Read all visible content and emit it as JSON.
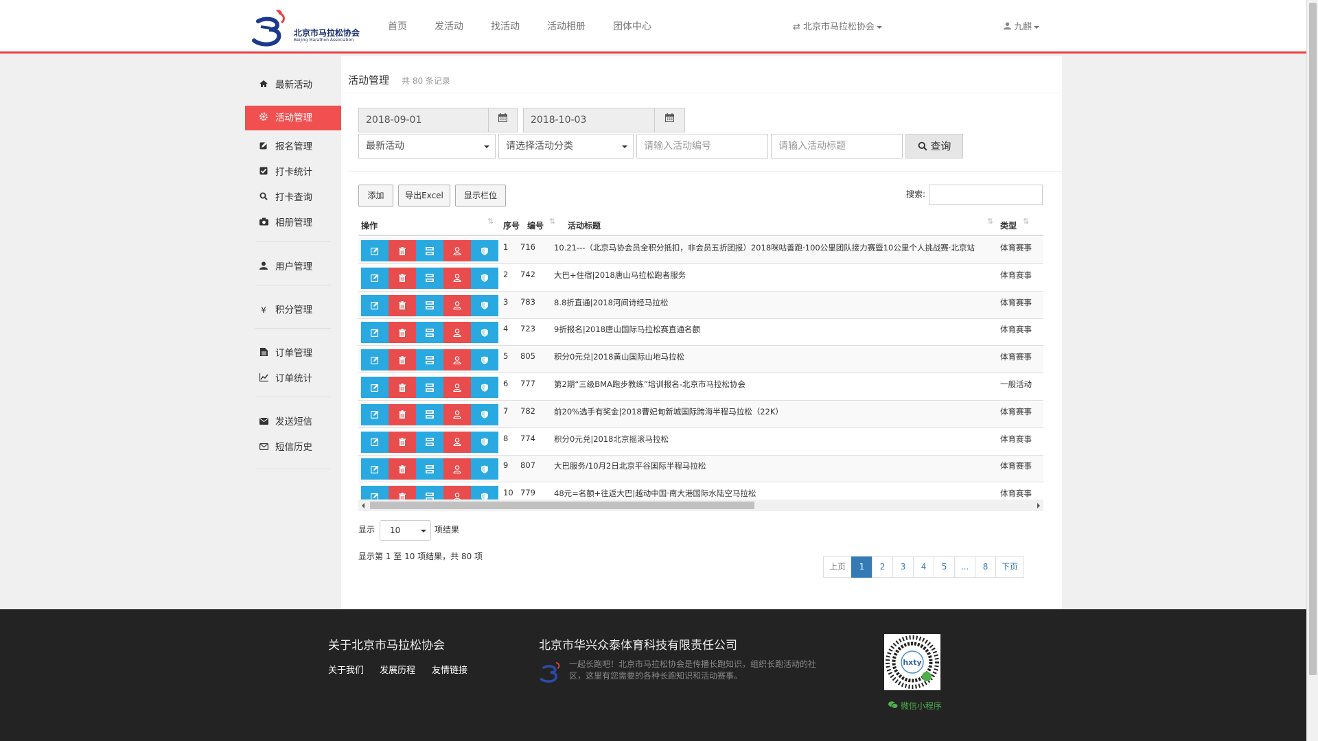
{
  "header": {
    "logo_text": "北京市马拉松协会",
    "logo_subtext": "Beijing Marathon Association",
    "nav": [
      "首页",
      "发活动",
      "找活动",
      "活动相册",
      "团体中心"
    ],
    "org_switch": "北京市马拉松协会",
    "user": "九麒"
  },
  "sidebar": {
    "items": [
      {
        "icon": "home-icon",
        "label": "最新活动"
      },
      {
        "icon": "gear-icon",
        "label": "活动管理"
      },
      {
        "icon": "edit-icon",
        "label": "报名管理"
      },
      {
        "icon": "check-square-icon",
        "label": "打卡统计"
      },
      {
        "icon": "search-icon",
        "label": "打卡查询"
      },
      {
        "icon": "camera-icon",
        "label": "相册管理"
      },
      {
        "icon": "user-icon",
        "label": "用户管理"
      },
      {
        "icon": "yen-icon",
        "label": "积分管理"
      },
      {
        "icon": "file-icon",
        "label": "订单管理"
      },
      {
        "icon": "line-chart-icon",
        "label": "订单统计"
      },
      {
        "icon": "envelope-icon",
        "label": "发送短信"
      },
      {
        "icon": "envelope-outline-icon",
        "label": "短信历史"
      }
    ],
    "active_index": 1
  },
  "main": {
    "title": "活动管理",
    "count": "共 80 条记录"
  },
  "filters": {
    "start_date": "2018-09-01",
    "end_date": "2018-10-03",
    "activity_type": "最新活动",
    "category_placeholder": "请选择活动分类",
    "id_placeholder": "请输入活动编号",
    "title_placeholder": "请输入活动标题",
    "query_label": "查询"
  },
  "toolbar": {
    "add": "添加",
    "export": "导出Excel",
    "columns": "显示栏位",
    "search_label": "搜索:"
  },
  "table": {
    "headers": [
      "操作",
      "序号",
      "编号",
      "活动标题",
      "类型"
    ],
    "rows": [
      {
        "seq": "1",
        "id": "716",
        "title": "10.21---（北京马协会员全积分抵扣，非会员五折团报）2018咪咕善跑·100公里团队接力赛暨10公里个人挑战赛·北京站",
        "type": "体育赛事"
      },
      {
        "seq": "2",
        "id": "742",
        "title": "大巴+住宿|2018唐山马拉松跑者服务",
        "type": "体育赛事"
      },
      {
        "seq": "3",
        "id": "783",
        "title": "8.8折直通|2018河间诗经马拉松",
        "type": "体育赛事"
      },
      {
        "seq": "4",
        "id": "723",
        "title": "9折报名|2018唐山国际马拉松赛直通名额",
        "type": "体育赛事"
      },
      {
        "seq": "5",
        "id": "805",
        "title": "积分0元兑|2018黄山国际山地马拉松",
        "type": "体育赛事"
      },
      {
        "seq": "6",
        "id": "777",
        "title": "第2期“三级BMA跑步教练”培训报名-北京市马拉松协会",
        "type": "一般活动"
      },
      {
        "seq": "7",
        "id": "782",
        "title": "前20%选手有奖金|2018曹妃甸新城国际跨海半程马拉松（22K）",
        "type": "体育赛事"
      },
      {
        "seq": "8",
        "id": "774",
        "title": "积分0元兑|2018北京摇滚马拉松",
        "type": "体育赛事"
      },
      {
        "seq": "9",
        "id": "807",
        "title": "大巴服务/10月2日北京平谷国际半程马拉松",
        "type": "体育赛事"
      },
      {
        "seq": "10",
        "id": "779",
        "title": "48元=名额+往返大巴|越动中国·南大港国际水陆空马拉松",
        "type": "体育赛事"
      }
    ],
    "ops": [
      {
        "name": "edit-icon",
        "color": "#29a9e0"
      },
      {
        "name": "trash-icon",
        "color": "#e84c4c"
      },
      {
        "name": "qrcode-icon",
        "color": "#29a9e0"
      },
      {
        "name": "user-icon",
        "color": "#e84c4c"
      },
      {
        "name": "shield-icon",
        "color": "#29a9e0"
      }
    ]
  },
  "length": {
    "prefix": "显示",
    "value": "10",
    "suffix": "项结果"
  },
  "info": "显示第 1 至 10 项结果，共 80 项",
  "pagination": [
    "上页",
    "1",
    "2",
    "3",
    "4",
    "5",
    "...",
    "8",
    "下页"
  ],
  "pagination_active": "1",
  "footer": {
    "about_title": "关于北京市马拉松协会",
    "links": [
      "关于我们",
      "发展历程",
      "友情链接"
    ],
    "company": "北京市华兴众泰体育科技有限责任公司",
    "desc": "一起长跑吧！北京市马拉松协会是传播长跑知识，组织长跑活动的社区，这里有您需要的各种长跑知识和活动赛事。",
    "mini_program": "微信小程序"
  },
  "colors": {
    "accent": "#e9403e",
    "active": "#f05050",
    "blue": "#29a9e0",
    "red": "#e84c4c",
    "pager_active": "#337ab7"
  }
}
